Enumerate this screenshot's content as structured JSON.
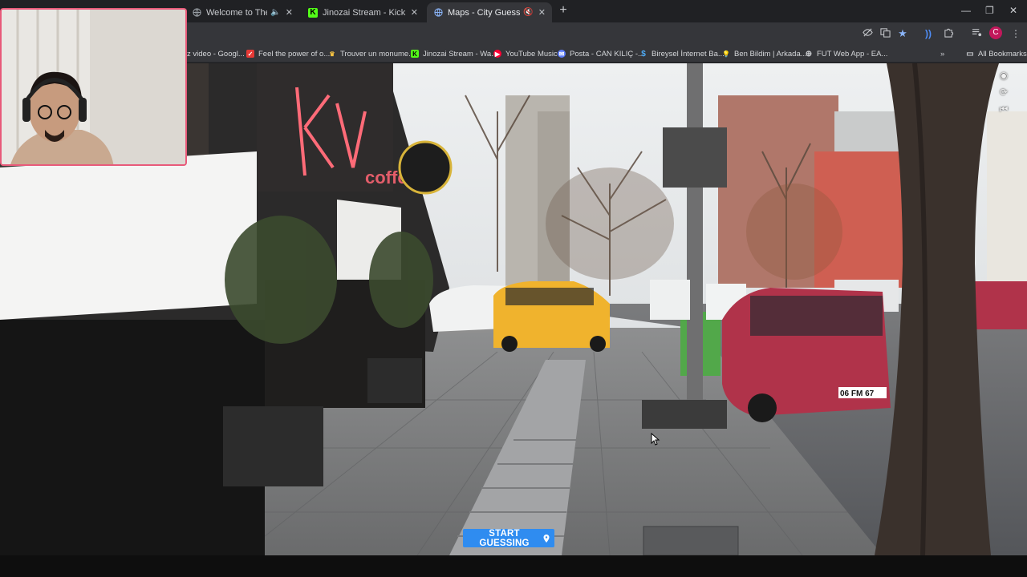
{
  "tabs": [
    {
      "title": "Welcome to The Internet | V",
      "icon": "globe-icon",
      "muted": true
    },
    {
      "title": "Jinozai Stream - Kick Dashboard",
      "icon": "kick-icon",
      "muted": false
    },
    {
      "title": "Maps - City Guesser",
      "icon": "globe-icon",
      "muted": true,
      "active": true
    }
  ],
  "new_tab_label": "+",
  "bookmarks": [
    {
      "label": "z video - Googl...",
      "icon": "google-icon"
    },
    {
      "label": "Feel the power of o...",
      "icon": "check-icon"
    },
    {
      "label": "Trouver un monume...",
      "icon": "crown-icon"
    },
    {
      "label": "Jinozai Stream - Wa...",
      "icon": "kick-icon"
    },
    {
      "label": "YouTube Music",
      "icon": "youtube-music-icon"
    },
    {
      "label": "Posta - CAN KILIÇ -...",
      "icon": "mail-icon"
    },
    {
      "label": "Bireysel İnternet Ba...",
      "icon": "dollar-icon"
    },
    {
      "label": "Ben Bildim | Arkada...",
      "icon": "lamp-icon"
    },
    {
      "label": "FUT Web App - EA...",
      "icon": "ea-icon"
    }
  ],
  "all_bookmarks_label": "All Bookmarks",
  "profile_initial": "C",
  "start_button": {
    "label": "START GUESSING",
    "icon": "map-pin-icon"
  },
  "colors": {
    "accent": "#2f8cf0",
    "tab_bg": "#202124",
    "toolbar_bg": "#35363a"
  }
}
